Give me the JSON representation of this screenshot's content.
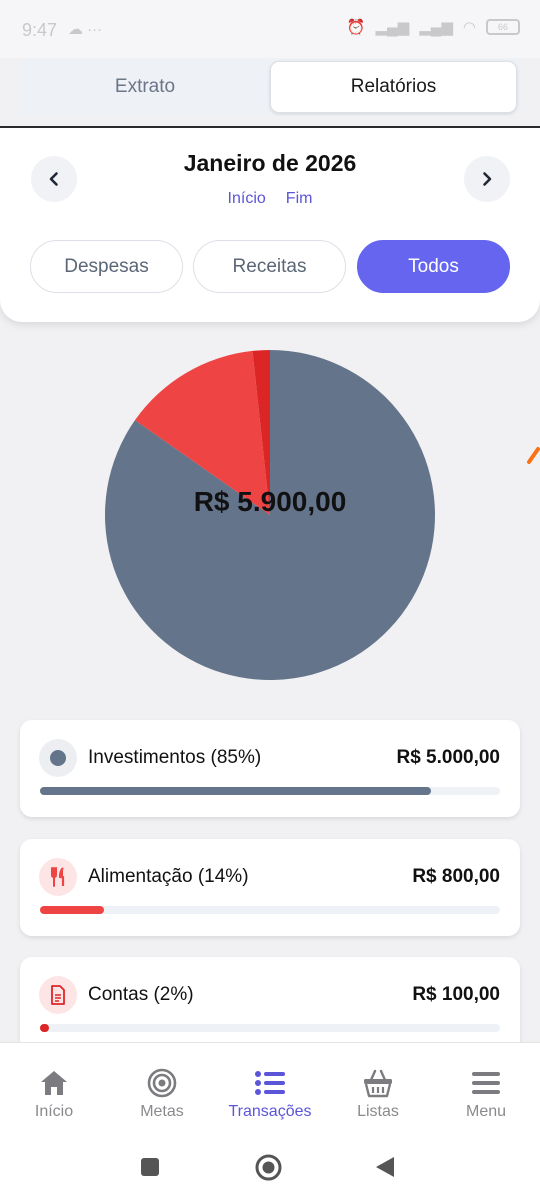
{
  "status_bar": {
    "time": "9:47",
    "battery": "66"
  },
  "tabs": {
    "extrato": "Extrato",
    "relatorios": "Relatórios"
  },
  "period": {
    "title": "Janeiro de 2026",
    "start_label": "Início",
    "end_label": "Fim"
  },
  "filters": {
    "despesas": "Despesas",
    "receitas": "Receitas",
    "todos": "Todos",
    "active": "Todos"
  },
  "chart_data": {
    "type": "pie",
    "center_label": "R$ 5.900,00",
    "slices": [
      {
        "name": "Investimentos",
        "value": 5000,
        "color": "#64748b"
      },
      {
        "name": "Alimentação",
        "value": 800,
        "color": "#ef4444"
      },
      {
        "name": "Contas",
        "value": 100,
        "color": "#dc2626"
      }
    ]
  },
  "categories": [
    {
      "label": "Investimentos (85%)",
      "value": "R$ 5.000,00",
      "percent": 85,
      "color": "#64748b",
      "icon_bg": "#eceef2",
      "icon": "circle-icon"
    },
    {
      "label": "Alimentação (14%)",
      "value": "R$ 800,00",
      "percent": 14,
      "color": "#ef4444",
      "icon_bg": "#fde5e5",
      "icon": "utensils-icon"
    },
    {
      "label": "Contas (2%)",
      "value": "R$ 100,00",
      "percent": 2,
      "color": "#dc2626",
      "icon_bg": "#fde5e5",
      "icon": "document-icon"
    }
  ],
  "bottom_nav": {
    "items": [
      {
        "label": "Início",
        "icon": "home-icon"
      },
      {
        "label": "Metas",
        "icon": "target-icon"
      },
      {
        "label": "Transações",
        "icon": "list-icon"
      },
      {
        "label": "Listas",
        "icon": "basket-icon"
      },
      {
        "label": "Menu",
        "icon": "menu-icon"
      }
    ],
    "active": "Transações"
  },
  "colors": {
    "accent": "#6565f0",
    "accent_text": "#5b55d8"
  }
}
